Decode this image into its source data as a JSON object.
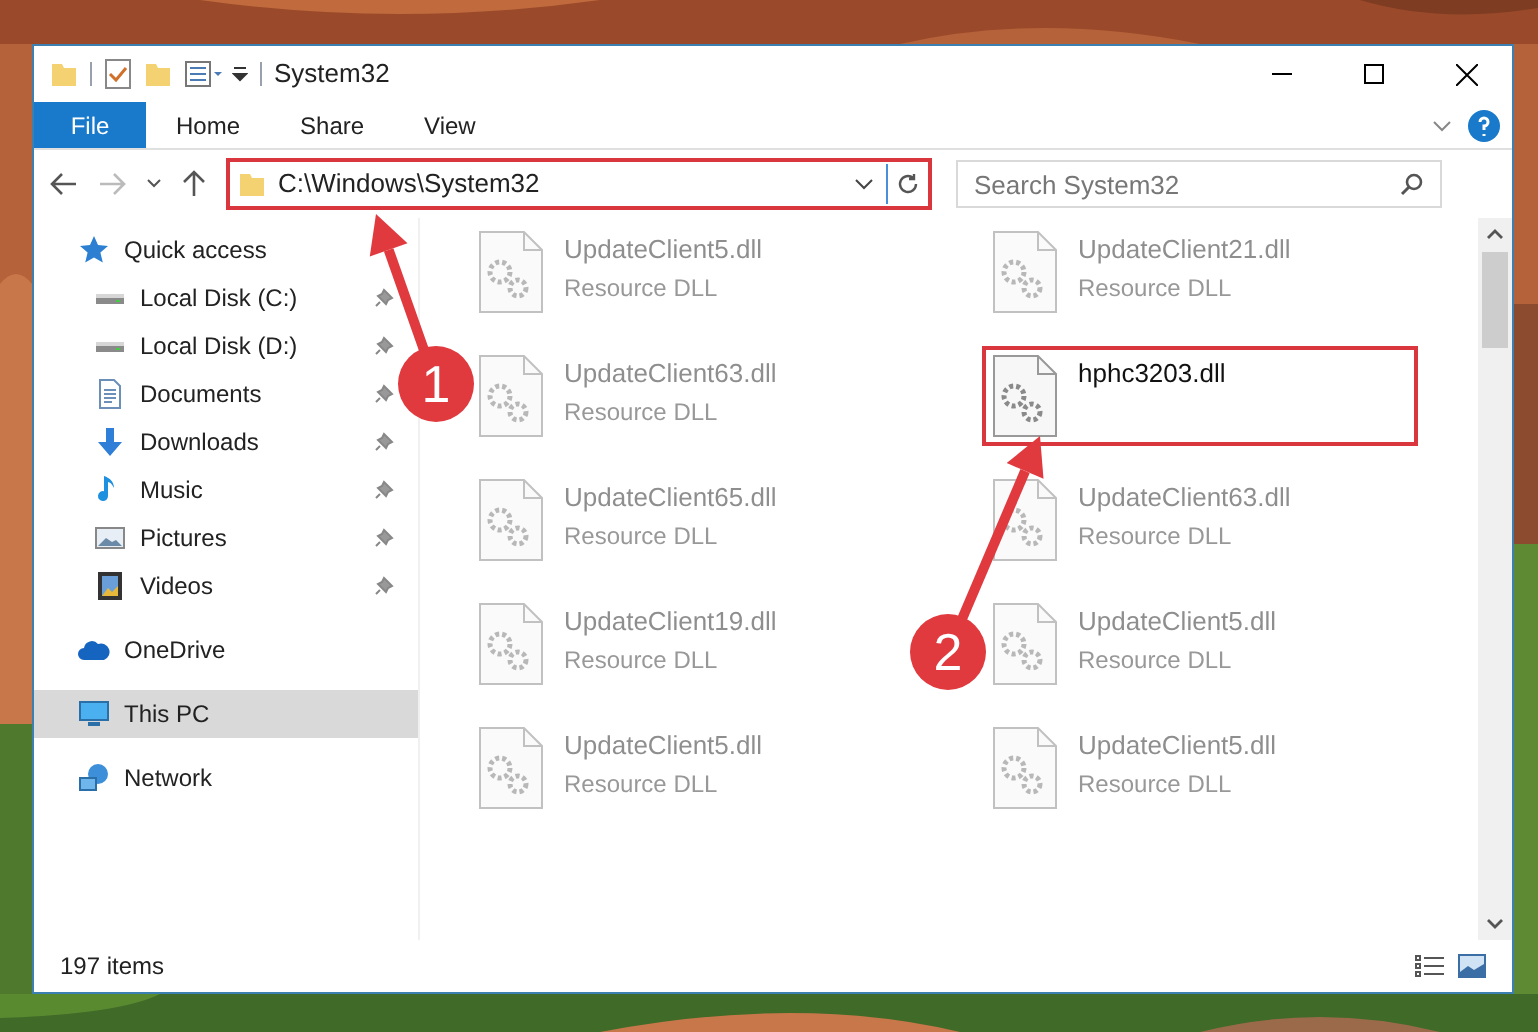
{
  "window": {
    "title": "System32"
  },
  "ribbon_tabs": [
    {
      "label": "File",
      "kind": "file"
    },
    {
      "label": "Home",
      "kind": "tab"
    },
    {
      "label": "Share",
      "kind": "tab"
    },
    {
      "label": "View",
      "kind": "tab"
    }
  ],
  "address": {
    "path": "C:\\Windows\\System32",
    "highlighted": true
  },
  "search": {
    "placeholder": "Search System32"
  },
  "nav": [
    {
      "label": "Quick access",
      "kind": "group",
      "pinned": false,
      "selected": false
    },
    {
      "label": "Local Disk (C:)",
      "kind": "place",
      "pinned": true,
      "selected": false
    },
    {
      "label": "Local Disk (D:)",
      "kind": "place",
      "pinned": true,
      "selected": false
    },
    {
      "label": "Documents",
      "kind": "place",
      "pinned": true,
      "selected": false
    },
    {
      "label": "Downloads",
      "kind": "place",
      "pinned": true,
      "selected": false
    },
    {
      "label": "Music",
      "kind": "place",
      "pinned": true,
      "selected": false
    },
    {
      "label": "Pictures",
      "kind": "place",
      "pinned": true,
      "selected": false
    },
    {
      "label": "Videos",
      "kind": "place",
      "pinned": true,
      "selected": false
    },
    {
      "label": "OneDrive",
      "kind": "group",
      "pinned": false,
      "selected": false
    },
    {
      "label": "This PC",
      "kind": "group",
      "pinned": false,
      "selected": true
    },
    {
      "label": "Network",
      "kind": "group",
      "pinned": false,
      "selected": false
    }
  ],
  "files": [
    {
      "name": "UpdateClient5.dll",
      "type": "Resource DLL",
      "faded": true,
      "highlighted": false
    },
    {
      "name": "UpdateClient21.dll",
      "type": "Resource DLL",
      "faded": true,
      "highlighted": false
    },
    {
      "name": "UpdateClient63.dll",
      "type": "Resource DLL",
      "faded": true,
      "highlighted": false
    },
    {
      "name": "hphc3203.dll",
      "faded": false,
      "highlighted": true
    },
    {
      "name": "UpdateClient65.dll",
      "type": "Resource DLL",
      "faded": true,
      "highlighted": false
    },
    {
      "name": "UpdateClient63.dll",
      "type": "Resource DLL",
      "faded": true,
      "highlighted": false
    },
    {
      "name": "UpdateClient19.dll",
      "type": "Resource DLL",
      "faded": true,
      "highlighted": false
    },
    {
      "name": "UpdateClient5.dll",
      "type": "Resource DLL",
      "faded": true,
      "highlighted": false
    },
    {
      "name": "UpdateClient5.dll",
      "type": "Resource DLL",
      "faded": true,
      "highlighted": false
    },
    {
      "name": "UpdateClient5.dll",
      "type": "Resource DLL",
      "faded": true,
      "highlighted": false
    }
  ],
  "status_bar": {
    "count": "197 items"
  },
  "callouts": [
    {
      "label": "1"
    },
    {
      "label": "2"
    }
  ]
}
